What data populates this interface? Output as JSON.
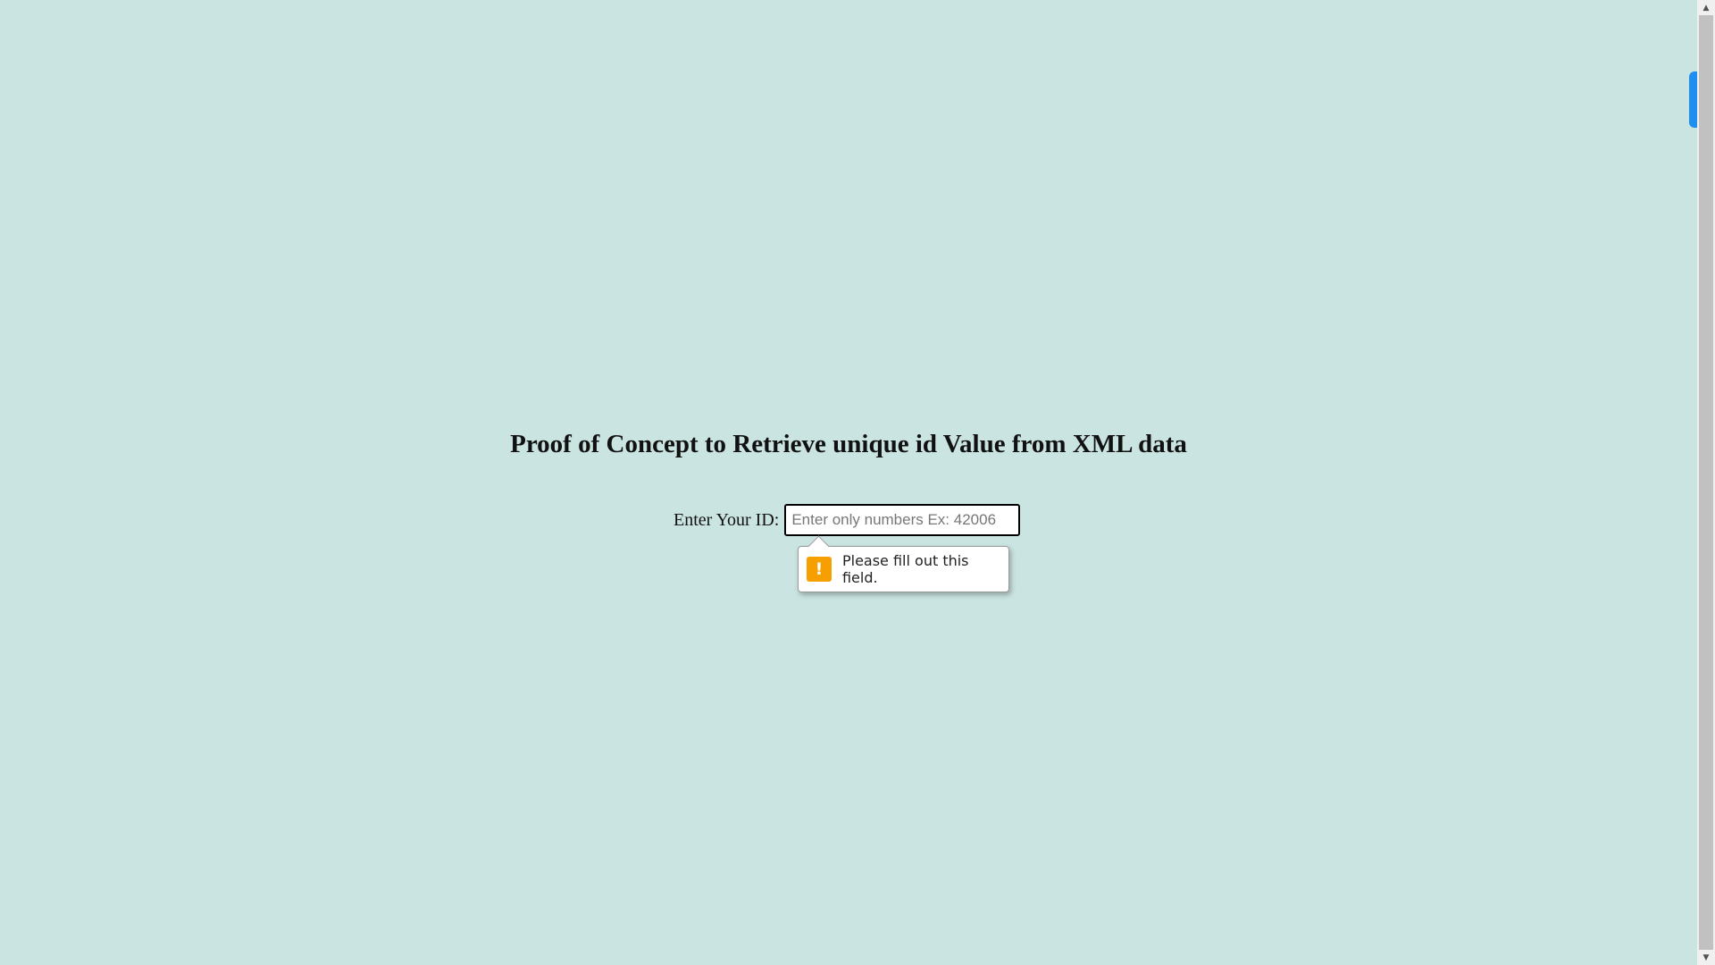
{
  "page": {
    "title": "Proof of Concept to Retrieve unique id Value from XML data",
    "background_color": "#cae4e2"
  },
  "form": {
    "label": "Enter Your ID:",
    "input_value": "",
    "input_placeholder": "Enter only numbers Ex: 42006"
  },
  "validation_tooltip": {
    "icon": "warning-icon",
    "icon_glyph": "!",
    "icon_color": "#f59f00",
    "message": "Please fill out this field."
  },
  "scrollbar": {
    "up_arrow": "▲",
    "down_arrow": "▼",
    "accent_color": "#1f8ef1"
  }
}
